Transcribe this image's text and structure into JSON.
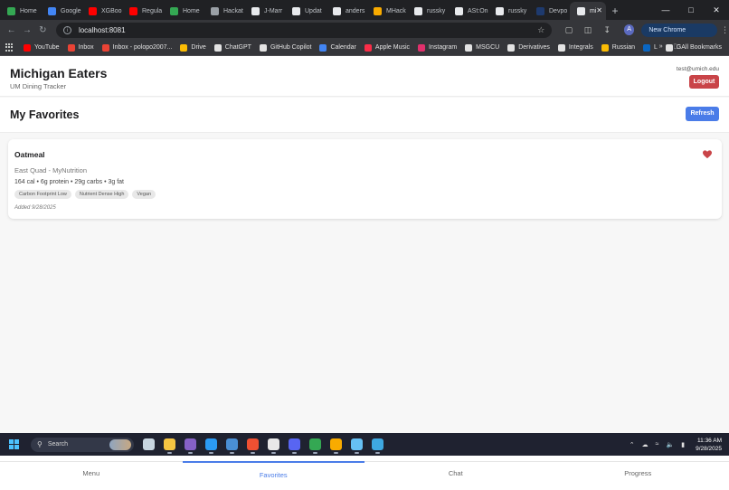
{
  "browser": {
    "tabs": [
      {
        "title": "Home",
        "color": "#34a853"
      },
      {
        "title": "Google",
        "color": "#4285f4"
      },
      {
        "title": "XGBoo",
        "color": "#ff0000"
      },
      {
        "title": "Regula",
        "color": "#ff0000"
      },
      {
        "title": "Home",
        "color": "#34a853"
      },
      {
        "title": "Hackat",
        "color": "#9aa0a6"
      },
      {
        "title": "J-Marr",
        "color": "#e8eaed"
      },
      {
        "title": "Updat",
        "color": "#e8eaed"
      },
      {
        "title": "anders",
        "color": "#e8eaed"
      },
      {
        "title": "MHack",
        "color": "#f9ab00"
      },
      {
        "title": "russky",
        "color": "#e8eaed"
      },
      {
        "title": "ASt:One",
        "color": "#e8eaed"
      },
      {
        "title": "russky",
        "color": "#e8eaed"
      },
      {
        "title": "Devpo",
        "color": "#1e3a6e"
      },
      {
        "title": "mi",
        "color": "#e8eaed",
        "active": true
      }
    ],
    "new_tab_glyph": "+",
    "url": "localhost:8081",
    "update_chip": "New Chrome available",
    "profile_initial": "A",
    "bookmarks": [
      {
        "label": "YouTube",
        "color": "#ff0000"
      },
      {
        "label": "Inbox",
        "color": "#ea4335"
      },
      {
        "label": "Inbox - polopo2007...",
        "color": "#ea4335"
      },
      {
        "label": "Drive",
        "color": "#fbbc04"
      },
      {
        "label": "ChatGPT",
        "color": "#e3e3e3"
      },
      {
        "label": "GitHub Copilot",
        "color": "#e3e3e3"
      },
      {
        "label": "Calendar",
        "color": "#4285f4"
      },
      {
        "label": "Apple Music",
        "color": "#fa2d48"
      },
      {
        "label": "Instagram",
        "color": "#e1306c"
      },
      {
        "label": "MSGCU",
        "color": "#e3e3e3"
      },
      {
        "label": "Derivatives",
        "color": "#e3e3e3"
      },
      {
        "label": "Integrals",
        "color": "#e3e3e3"
      },
      {
        "label": "Russian",
        "color": "#fbbc04"
      },
      {
        "label": "L",
        "color": "#0a66c2"
      },
      {
        "label": "G",
        "color": "#e3e3e3"
      }
    ],
    "all_bookmarks": "All Bookmarks"
  },
  "app": {
    "brand": "Michigan Eaters",
    "tagline": "UM Dining Tracker",
    "user_email": "test@umich.edu",
    "logout_label": "Logout",
    "page_title": "My Favorites",
    "refresh_label": "Refresh",
    "favorites": [
      {
        "name": "Oatmeal",
        "location": "East Quad - MyNutrition",
        "nutrition": "164 cal • 6g protein • 29g carbs • 3g fat",
        "tags": [
          "Carbon Footprint Low",
          "Nutrient Dense High",
          "Vegan"
        ],
        "added": "Added 9/28/2025",
        "heart_color": "#c94448"
      }
    ],
    "bottom_nav": [
      {
        "label": "Menu"
      },
      {
        "label": "Favorites",
        "active": true
      },
      {
        "label": "Chat"
      },
      {
        "label": "Progress"
      }
    ],
    "accent_color": "#4a7ce8"
  },
  "taskbar": {
    "search_label": "Search",
    "apps": [
      {
        "icon": "steam-icon",
        "color": "#c7d5e0"
      },
      {
        "icon": "file-explorer-icon",
        "color": "#f5c542"
      },
      {
        "icon": "visual-studio-icon",
        "color": "#8661c5"
      },
      {
        "icon": "vscode-icon",
        "color": "#2b9bf4"
      },
      {
        "icon": "app-icon",
        "color": "#4a8fd4"
      },
      {
        "icon": "git-icon",
        "color": "#f05032"
      },
      {
        "icon": "slack-icon",
        "color": "#e8e8e8"
      },
      {
        "icon": "discord-icon",
        "color": "#5865f2"
      },
      {
        "icon": "chrome-icon",
        "color": "#34a853"
      },
      {
        "icon": "chrome-canary-icon",
        "color": "#f9ab00"
      },
      {
        "icon": "steam-tray-icon",
        "color": "#66c0f4"
      },
      {
        "icon": "notepad-icon",
        "color": "#3ea8e0"
      }
    ],
    "time": "11:36 AM",
    "date": "9/28/2025"
  }
}
